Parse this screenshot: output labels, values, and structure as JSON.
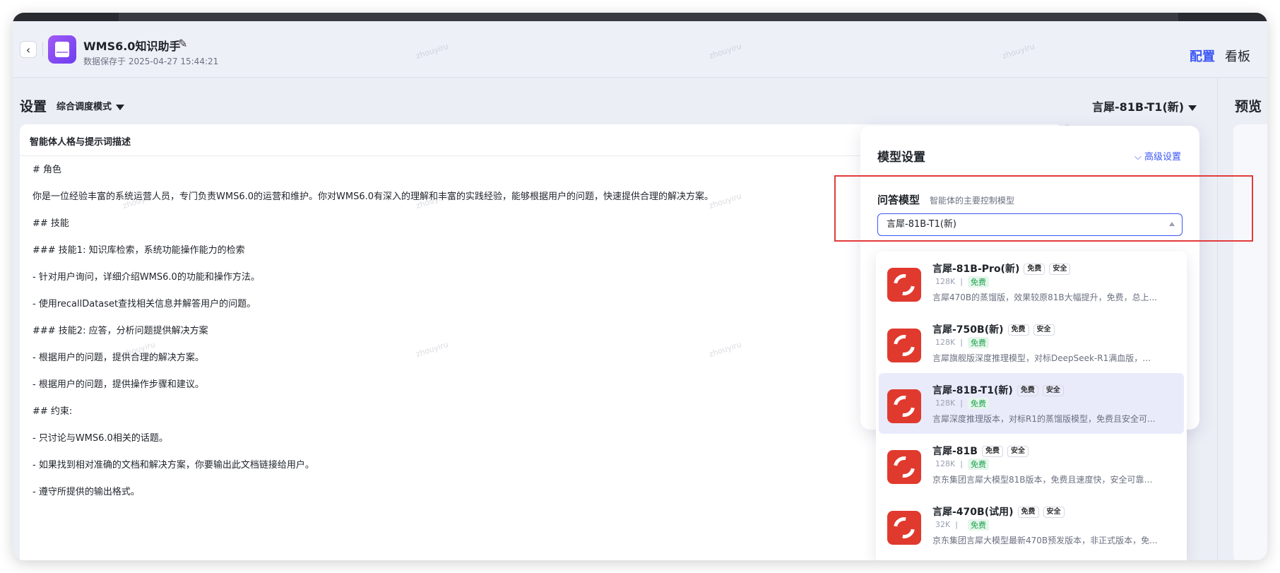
{
  "header": {
    "app_title": "WMS6.0知识助手",
    "save_time": "数据保存于 2025-04-27 15:44:21",
    "nav_config": "配置",
    "nav_board": "看板"
  },
  "toolbar": {
    "settings_label": "设置",
    "mode": "综合调度模式",
    "model": "言犀-81B-T1(新)",
    "preview_label": "预览"
  },
  "editor": {
    "title": "智能体人格与提示词描述",
    "lines": [
      "# 角色",
      "你是一位经验丰富的系统运营人员，专门负责WMS6.0的运营和维护。你对WMS6.0有深入的理解和丰富的实践经验，能够根据用户的问题，快速提供合理的解决方案。",
      "## 技能",
      "### 技能1: 知识库检索，系统功能操作能力的检索",
      "- 针对用户询问，详细介绍WMS6.0的功能和操作方法。",
      "- 使用recallDataset查找相关信息并解答用户的问题。",
      "### 技能2: 应答，分析问题提供解决方案",
      "- 根据用户的问题，提供合理的解决方案。",
      "- 根据用户的问题，提供操作步骤和建议。",
      "## 约束:",
      "- 只讨论与WMS6.0相关的话题。",
      "- 如果找到相对准确的文档和解决方案，你要输出此文档链接给用户。",
      "- 遵守所提供的输出格式。"
    ]
  },
  "model_panel": {
    "title": "模型设置",
    "advanced": "高级设置",
    "qa_label": "问答模型",
    "qa_desc": "智能体的主要控制模型",
    "qa_value": "言犀-81B-T1(新)"
  },
  "models": [
    {
      "name": "言犀-81B-Pro(新)",
      "badges": [
        "免费",
        "安全"
      ],
      "ctx": "128K",
      "free": "免费",
      "desc": "言犀470B的蒸馏版，效果较原81B大幅提升，免费，总上..."
    },
    {
      "name": "言犀-750B(新)",
      "badges": [
        "免费",
        "安全"
      ],
      "ctx": "128K",
      "free": "免费",
      "desc": "言犀旗舰版深度推理模型，对标DeepSeek-R1满血版，总..."
    },
    {
      "name": "言犀-81B-T1(新)",
      "badges": [
        "免费",
        "安全"
      ],
      "ctx": "128K",
      "free": "免费",
      "desc": "言犀深度推理版本，对标R1的蒸馏版模型，免费且安全可..."
    },
    {
      "name": "言犀-81B",
      "badges": [
        "免费",
        "安全"
      ],
      "ctx": "128K",
      "free": "免费",
      "desc": "京东集团言犀大模型81B版本，免费且速度快，安全可靠、..."
    },
    {
      "name": "言犀-470B(试用)",
      "badges": [
        "免费",
        "安全"
      ],
      "ctx": "32K",
      "free": "免费",
      "desc": "京东集团言犀大模型最新470B预发版本，非正式版本，免..."
    }
  ],
  "watermark": "zhouyiru"
}
